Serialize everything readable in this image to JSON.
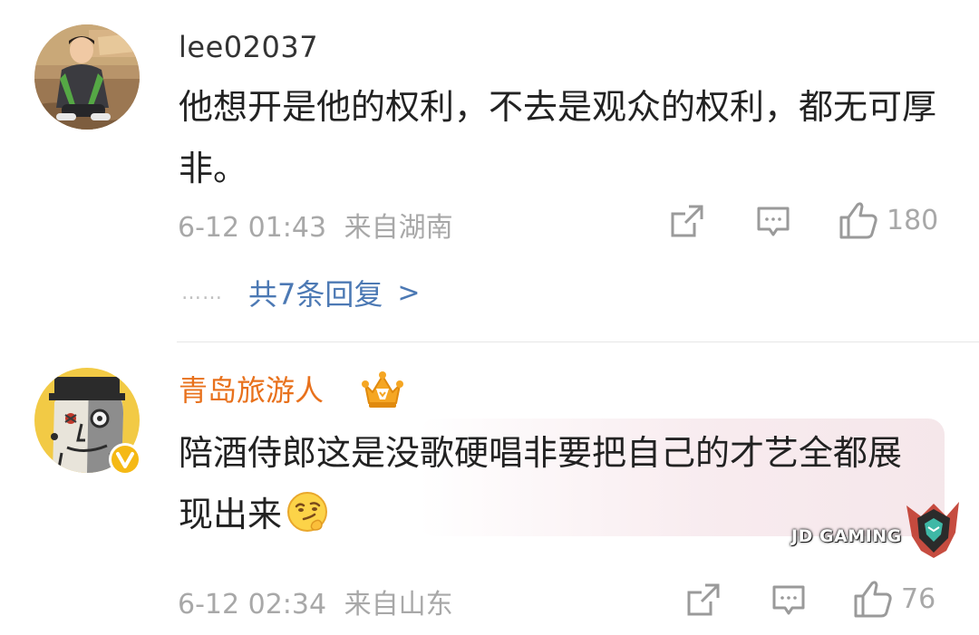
{
  "comments": [
    {
      "username": "lee02037",
      "text": "他想开是他的权利，不去是观众的权利，都无可厚非。",
      "date": "6-12 01:43",
      "location": "来自湖南",
      "likes": "180",
      "replies_label": "共7条回复",
      "replies_dots": "……",
      "replies_arrow": ">"
    },
    {
      "username": "青岛旅游人",
      "text": "陪酒侍郎这是没歌硬唱非要把自己的才艺全都展现出来",
      "date": "6-12 02:34",
      "location": "来自山东",
      "likes": "76"
    }
  ],
  "watermark": {
    "text": "JD GAMING"
  },
  "icons": {
    "repost": "repost-icon",
    "comment": "comment-icon",
    "like": "thumbs-up-icon",
    "vip": "crown-vip-icon",
    "verified": "verified-v-icon",
    "emoji": "smirk-emoji-icon"
  },
  "colors": {
    "username_default": "#333333",
    "username_vip": "#e8711c",
    "link": "#4c79b4",
    "meta": "#a8a8a8"
  }
}
